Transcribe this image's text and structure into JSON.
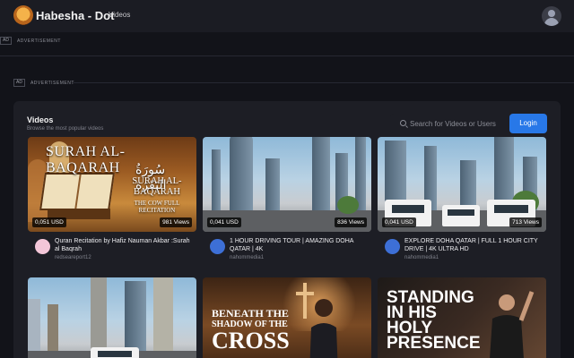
{
  "header": {
    "brand": "Habesha - Dot",
    "nav": [
      {
        "label": "Videos"
      }
    ]
  },
  "ads": [
    {
      "tag": "AD",
      "label": "ADVERTISEMENT"
    },
    {
      "tag": "AD",
      "label": "ADVERTISEMENT"
    }
  ],
  "videos_section": {
    "title": "Videos",
    "subtitle": "Browse the most popular videos",
    "search_placeholder": "Search for Videos or Users",
    "login_label": "Login"
  },
  "videos": [
    {
      "thumb_text": {
        "title": "SURAH AL-BAQARAH",
        "arabic": "سُورَةُ البَقَرَة",
        "big": "SURAH AL-BAQARAH",
        "small": "THE COW FULL RECITATION"
      },
      "price": "0,051 USD",
      "views": "981 Views",
      "title": "Quran Recitation by Hafiz Nauman Akbar :Surah al Baqrah",
      "channel": "redseareport12",
      "avatar_color": "#f3c6d8"
    },
    {
      "price": "0,041 USD",
      "views": "836 Views",
      "title": "1 HOUR DRIVING TOUR | AMAZING DOHA QATAR | 4K",
      "channel": "nahommedia1",
      "avatar_color": "#3d6fd6"
    },
    {
      "price": "0,041 USD",
      "views": "713 Views",
      "title": "EXPLORE DOHA QATAR | FULL 1 HOUR CITY DRIVE | 4K ULTRA HD",
      "channel": "nahommedia1",
      "avatar_color": "#3d6fd6"
    },
    {},
    {
      "thumb_text": {
        "line1": "BENEATH THE",
        "line2": "SHADOW OF THE",
        "line3": "CROSS"
      }
    },
    {
      "thumb_text": {
        "line1": "STANDING",
        "line2": "IN HIS",
        "line3": "HOLY",
        "line4": "PRESENCE"
      }
    }
  ]
}
